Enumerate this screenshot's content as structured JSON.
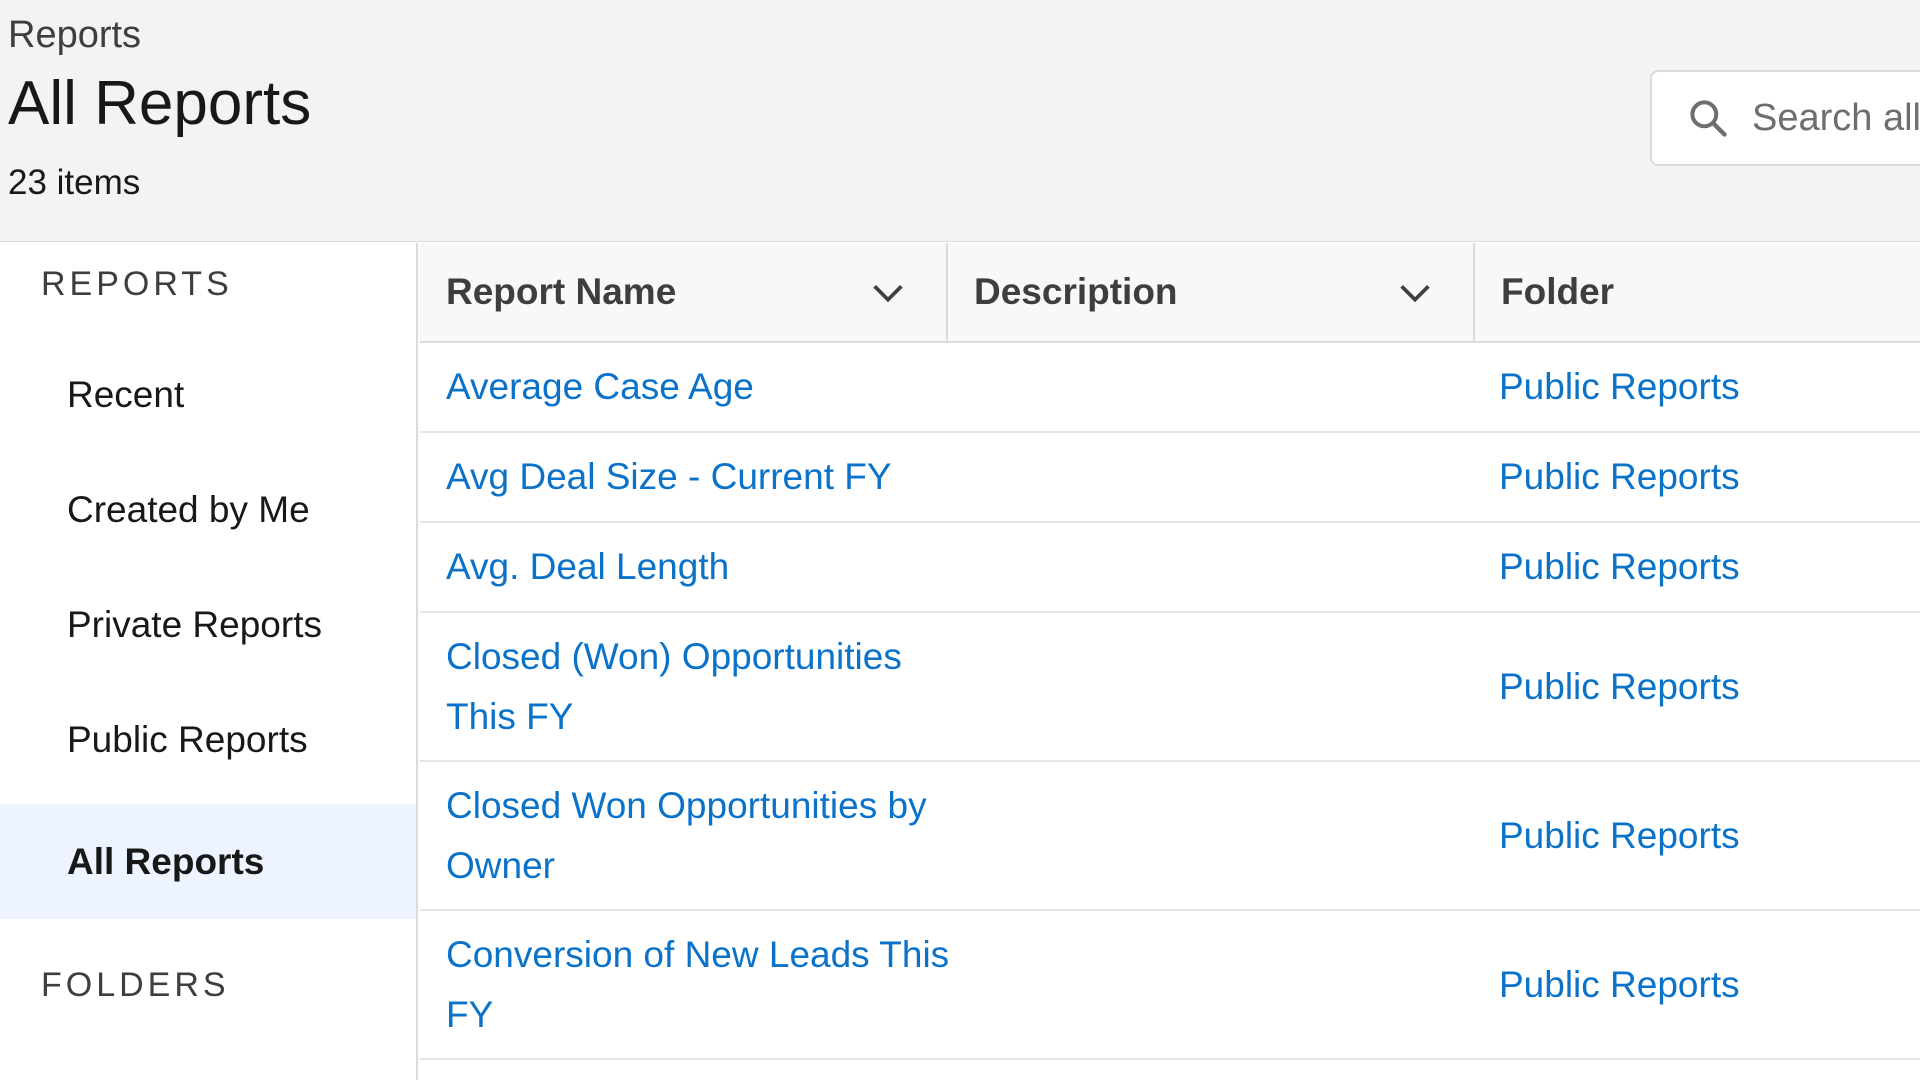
{
  "header": {
    "breadcrumb": "Reports",
    "title": "All Reports",
    "item_count": "23 items",
    "search_placeholder": "Search all"
  },
  "sidebar": {
    "reports_heading": "REPORTS",
    "items": [
      {
        "label": "Recent"
      },
      {
        "label": "Created by Me"
      },
      {
        "label": "Private Reports"
      },
      {
        "label": "Public Reports"
      },
      {
        "label": "All Reports",
        "active": true
      }
    ],
    "folders_heading": "FOLDERS"
  },
  "table": {
    "columns": [
      "Report Name",
      "Description",
      "Folder"
    ],
    "rows": [
      {
        "name": "Average Case Age",
        "description": "",
        "folder": "Public Reports"
      },
      {
        "name": "Avg Deal Size - Current FY",
        "description": "",
        "folder": "Public Reports"
      },
      {
        "name": "Avg. Deal Length",
        "description": "",
        "folder": "Public Reports"
      },
      {
        "name": "Closed (Won) Opportunities This FY",
        "description": "",
        "folder": "Public Reports"
      },
      {
        "name": "Closed Won Opportunities by Owner",
        "description": "",
        "folder": "Public Reports"
      },
      {
        "name": "Conversion of New Leads This FY",
        "description": "",
        "folder": "Public Reports"
      }
    ]
  },
  "colors": {
    "link": "#0b72c9",
    "header_bg": "#f3f3f3",
    "active_nav_bg": "#eef4ff",
    "border": "#dddbda"
  }
}
